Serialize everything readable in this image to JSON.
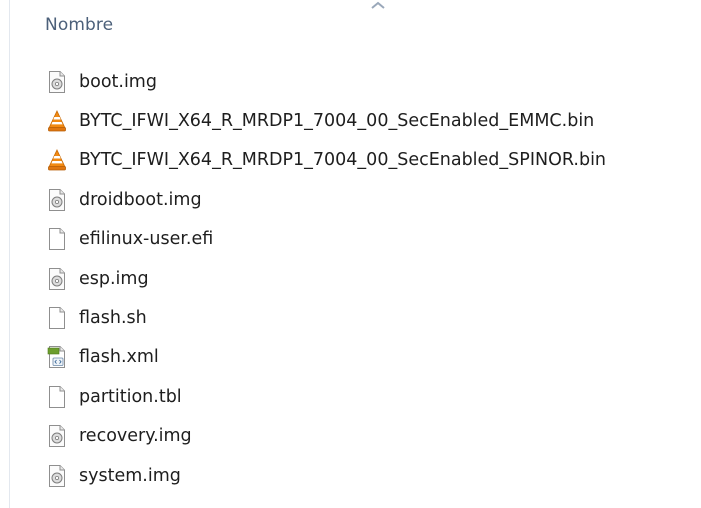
{
  "header": {
    "column_label": "Nombre"
  },
  "files": [
    {
      "name": "boot.img",
      "icon": "disk-image-file-icon"
    },
    {
      "name": "BYTC_IFWI_X64_R_MRDP1_7004_00_SecEnabled_EMMC.bin",
      "icon": "vlc-cone-file-icon"
    },
    {
      "name": "BYTC_IFWI_X64_R_MRDP1_7004_00_SecEnabled_SPINOR.bin",
      "icon": "vlc-cone-file-icon"
    },
    {
      "name": "droidboot.img",
      "icon": "disk-image-file-icon"
    },
    {
      "name": "efilinux-user.efi",
      "icon": "blank-file-icon"
    },
    {
      "name": "esp.img",
      "icon": "disk-image-file-icon"
    },
    {
      "name": "flash.sh",
      "icon": "blank-file-icon"
    },
    {
      "name": "flash.xml",
      "icon": "xml-file-icon"
    },
    {
      "name": "partition.tbl",
      "icon": "blank-file-icon"
    },
    {
      "name": "recovery.img",
      "icon": "disk-image-file-icon"
    },
    {
      "name": "system.img",
      "icon": "disk-image-file-icon"
    }
  ],
  "colors": {
    "header_text": "#4c607a",
    "file_text": "#1e1e1e",
    "vlc_orange": "#f28a12"
  }
}
